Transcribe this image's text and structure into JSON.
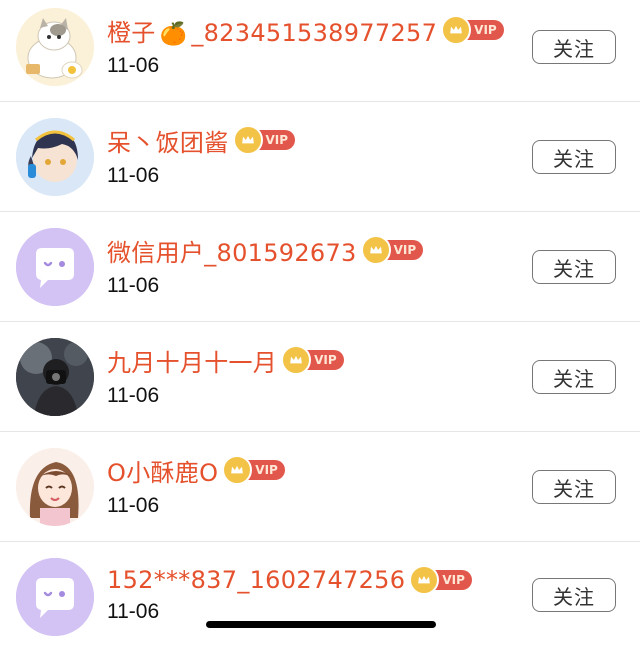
{
  "follow_label": "关注",
  "vip_label": "VIP",
  "users": [
    {
      "name_prefix": "橙子",
      "emoji": "🍊",
      "name_suffix": "_823451538977257",
      "date": "11-06",
      "avatar": "cat-avatar"
    },
    {
      "name_prefix": "呆丶饭团酱",
      "emoji": "",
      "name_suffix": "",
      "date": "11-06",
      "avatar": "anime-boy-avatar"
    },
    {
      "name_prefix": "微信用户_801592673",
      "emoji": "",
      "name_suffix": "",
      "date": "11-06",
      "avatar": "default-chat-avatar"
    },
    {
      "name_prefix": "九月十月十一月",
      "emoji": "",
      "name_suffix": "",
      "date": "11-06",
      "avatar": "photographer-avatar"
    },
    {
      "name_prefix": "O小酥鹿O",
      "emoji": "",
      "name_suffix": "",
      "date": "11-06",
      "avatar": "anime-girl-avatar"
    },
    {
      "name_prefix": "152***837_1602747256",
      "emoji": "",
      "name_suffix": "",
      "date": "11-06",
      "avatar": "default-chat-avatar"
    }
  ]
}
